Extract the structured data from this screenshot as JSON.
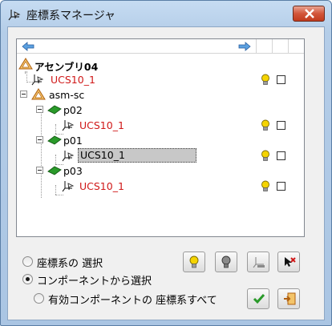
{
  "window": {
    "title": "座標系マネージャ"
  },
  "tree": {
    "rows": [
      {
        "label": "アセンブリ04",
        "kind": "assembly-root"
      },
      {
        "label": "UCS10_1",
        "kind": "ucs"
      },
      {
        "label": "asm-sc",
        "kind": "assembly"
      },
      {
        "label": "p02",
        "kind": "part"
      },
      {
        "label": "UCS10_1",
        "kind": "ucs"
      },
      {
        "label": "p01",
        "kind": "part"
      },
      {
        "label": "UCS10_1",
        "kind": "ucs-selected"
      },
      {
        "label": "p03",
        "kind": "part"
      },
      {
        "label": "UCS10_1",
        "kind": "ucs"
      }
    ]
  },
  "options": {
    "radio1": "座標系の 選択",
    "radio2": "コンポーネントから選択",
    "radio3": "有効コンポーネントの 座標系すべて",
    "selected": "radio2"
  },
  "colors": {
    "ucs_label": "#d01818",
    "accent_green": "#2a9a2a",
    "bulb_on": "#f5d400"
  },
  "icons": {
    "title": "coordinate-system-icon",
    "close": "close-icon",
    "nav_left": "arrow-left-icon",
    "nav_right": "arrow-right-icon",
    "bulb": "lightbulb-icon",
    "ok": "checkmark-icon",
    "cancel": "exit-icon"
  }
}
